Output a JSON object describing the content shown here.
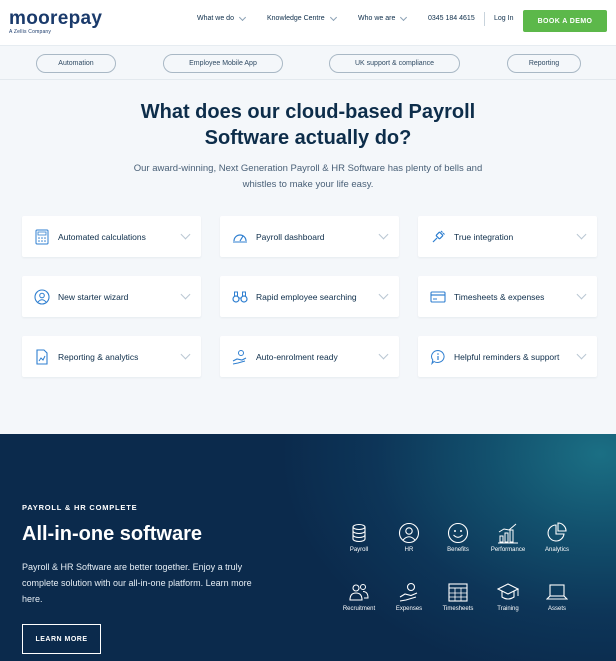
{
  "header": {
    "logo": "moorepay",
    "logo_sub": "A Zellis Company",
    "nav": [
      "What we do",
      "Knowledge Centre",
      "Who we are"
    ],
    "phone": "0345 184 4615",
    "login": "Log In",
    "cta": "BOOK A DEMO"
  },
  "pills": [
    "Automation",
    "Employee Mobile App",
    "UK support & compliance",
    "Reporting"
  ],
  "hero": {
    "title_line1": "What does our cloud-based Payroll",
    "title_line2": "Software actually do?",
    "lead_line1": "Our award-winning, Next Generation Payroll & HR Software has plenty of bells and",
    "lead_line2": "whistles to make your life easy."
  },
  "features": [
    {
      "label": "Automated calculations",
      "icon": "calculator-icon"
    },
    {
      "label": "Payroll dashboard",
      "icon": "gauge-icon"
    },
    {
      "label": "True integration",
      "icon": "plug-icon"
    },
    {
      "label": "New starter wizard",
      "icon": "user-circle-icon"
    },
    {
      "label": "Rapid employee searching",
      "icon": "binoculars-icon"
    },
    {
      "label": "Timesheets & expenses",
      "icon": "card-icon"
    },
    {
      "label": "Reporting & analytics",
      "icon": "report-icon"
    },
    {
      "label": "Auto-enrolment ready",
      "icon": "hand-coin-icon"
    },
    {
      "label": "Helpful reminders & support",
      "icon": "info-bubble-icon"
    }
  ],
  "complete": {
    "eyebrow": "PAYROLL & HR COMPLETE",
    "title": "All-in-one software",
    "text_line1": "Payroll & HR Software are better together. Enjoy a truly",
    "text_line2": "complete solution with our all-in-one platform. Learn more",
    "text_line3": "here.",
    "button": "LEARN MORE",
    "modules": [
      "Payroll",
      "HR",
      "Benefits",
      "Performance",
      "Analytics",
      "Recruitment",
      "Expenses",
      "Timesheets",
      "Training",
      "Assets"
    ]
  },
  "colors": {
    "brand": "#1a3a6b",
    "accent": "#5cb84a",
    "icon_blue": "#2f7fd0",
    "dark_bg": "#0b2a4c"
  }
}
